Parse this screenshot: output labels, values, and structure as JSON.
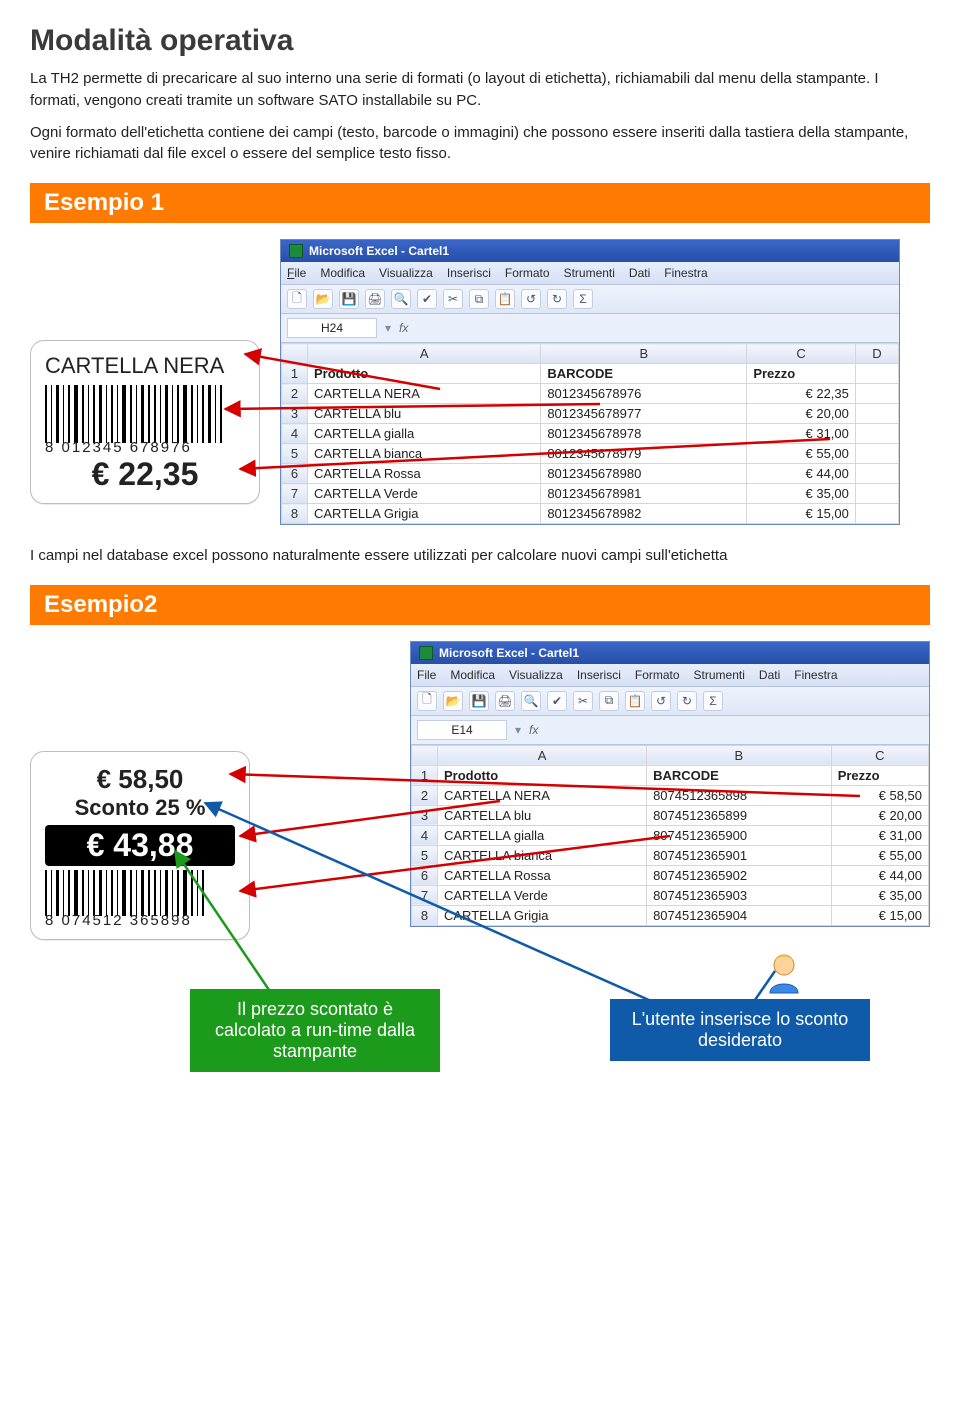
{
  "title": "Modalità operativa",
  "intro": "La TH2 permette di precaricare al suo interno una serie di formati (o layout di etichetta), richiamabili dal menu della stampante. I formati, vengono creati tramite un software SATO installabile su PC.",
  "intro2": "Ogni formato dell'etichetta contiene dei campi (testo, barcode o immagini) che possono essere inseriti dalla tastiera della stampante, venire richiamati dal file excel o essere del semplice testo fisso.",
  "example1": {
    "banner": "Esempio 1",
    "label": {
      "product": "CARTELLA NERA",
      "barcode_human": "8 012345 678976",
      "price": "€ 22,35"
    },
    "excel": {
      "window_title": "Microsoft Excel - Cartel1",
      "menu": {
        "file": "File",
        "modifica": "Modifica",
        "visualizza": "Visualizza",
        "inserisci": "Inserisci",
        "formato": "Formato",
        "strumenti": "Strumenti",
        "dati": "Dati",
        "finestra": "Finestra"
      },
      "namebox": "H24",
      "fx": "fx",
      "cols": [
        "",
        "A",
        "B",
        "C",
        "D"
      ],
      "headers": {
        "a": "Prodotto",
        "b": "BARCODE",
        "c": "Prezzo"
      },
      "rows": [
        {
          "n": "2",
          "a": "CARTELLA NERA",
          "b": "8012345678976",
          "c": "€ 22,35"
        },
        {
          "n": "3",
          "a": "CARTELLA blu",
          "b": "8012345678977",
          "c": "€ 20,00"
        },
        {
          "n": "4",
          "a": "CARTELLA gialla",
          "b": "8012345678978",
          "c": "€ 31,00"
        },
        {
          "n": "5",
          "a": "CARTELLA bianca",
          "b": "8012345678979",
          "c": "€ 55,00"
        },
        {
          "n": "6",
          "a": "CARTELLA Rossa",
          "b": "8012345678980",
          "c": "€ 44,00"
        },
        {
          "n": "7",
          "a": "CARTELLA Verde",
          "b": "8012345678981",
          "c": "€ 35,00"
        },
        {
          "n": "8",
          "a": "CARTELLA Grigia",
          "b": "8012345678982",
          "c": "€ 15,00"
        }
      ]
    }
  },
  "midtext": "I campi nel database excel possono naturalmente essere utilizzati per calcolare nuovi campi sull'etichetta",
  "example2": {
    "banner": "Esempio2",
    "label": {
      "orig_price": "€ 58,50",
      "discount_line": "Sconto 25 %",
      "final_price": "€ 43,88",
      "barcode_human": "8 074512 365898"
    },
    "excel": {
      "window_title": "Microsoft Excel - Cartel1",
      "menu": {
        "file": "File",
        "modifica": "Modifica",
        "visualizza": "Visualizza",
        "inserisci": "Inserisci",
        "formato": "Formato",
        "strumenti": "Strumenti",
        "dati": "Dati",
        "finestra": "Finestra"
      },
      "namebox": "E14",
      "fx": "fx",
      "cols": [
        "",
        "A",
        "B",
        "C"
      ],
      "headers": {
        "a": "Prodotto",
        "b": "BARCODE",
        "c": "Prezzo"
      },
      "rows": [
        {
          "n": "2",
          "a": "CARTELLA NERA",
          "b": "8074512365898",
          "c": "€ 58,50"
        },
        {
          "n": "3",
          "a": "CARTELLA blu",
          "b": "8074512365899",
          "c": "€ 20,00"
        },
        {
          "n": "4",
          "a": "CARTELLA gialla",
          "b": "8074512365900",
          "c": "€ 31,00"
        },
        {
          "n": "5",
          "a": "CARTELLA bianca",
          "b": "8074512365901",
          "c": "€ 55,00"
        },
        {
          "n": "6",
          "a": "CARTELLA Rossa",
          "b": "8074512365902",
          "c": "€ 44,00"
        },
        {
          "n": "7",
          "a": "CARTELLA Verde",
          "b": "8074512365903",
          "c": "€ 35,00"
        },
        {
          "n": "8",
          "a": "CARTELLA Grigia",
          "b": "8074512365904",
          "c": "€ 15,00"
        }
      ]
    }
  },
  "callouts": {
    "green": "Il prezzo scontato è calcolato a run-time dalla stampante",
    "blue": "L'utente inserisce lo sconto desiderato"
  },
  "icons": {
    "new": "🗋",
    "open": "📂",
    "save": "💾",
    "print": "🖨",
    "preview": "🔍",
    "spell": "✔",
    "cut": "✂",
    "copy": "⧉",
    "paste": "📋",
    "undo": "↺",
    "redo": "↻",
    "sum": "Σ"
  }
}
